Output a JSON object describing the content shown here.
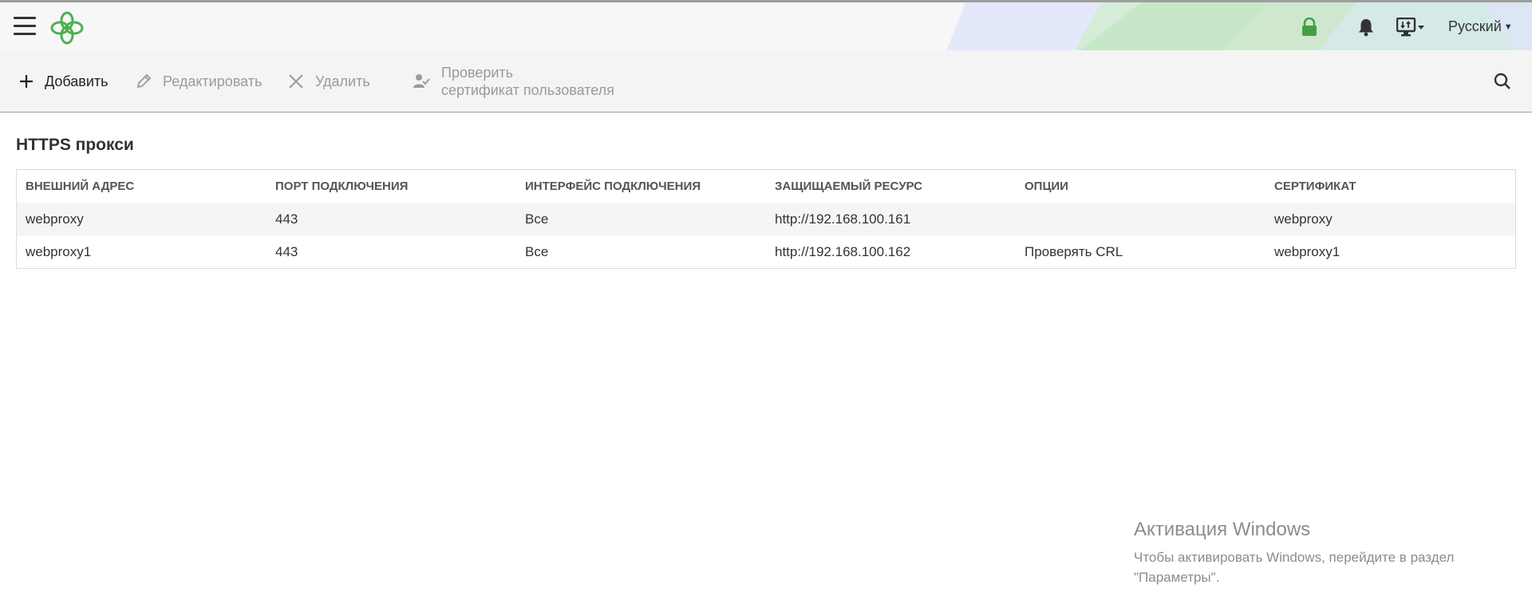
{
  "header": {
    "language": "Русский",
    "icons": {
      "menu": "hamburger-menu-icon",
      "logo": "app-logo",
      "lock": "lock-icon",
      "bell": "bell-icon",
      "display": "display-icon"
    },
    "colors": {
      "accent": "#4caf50",
      "lock": "#43a047"
    }
  },
  "toolbar": {
    "add_label": "Добавить",
    "edit_label": "Редактировать",
    "delete_label": "Удалить",
    "check_cert_line1": "Проверить",
    "check_cert_line2": "сертификат пользователя"
  },
  "page": {
    "title": "HTTPS прокси"
  },
  "table": {
    "columns": [
      "ВНЕШНИЙ АДРЕС",
      "ПОРТ ПОДКЛЮЧЕНИЯ",
      "ИНТЕРФЕЙС ПОДКЛЮЧЕНИЯ",
      "ЗАЩИЩАЕМЫЙ РЕСУРС",
      "ОПЦИИ",
      "СЕРТИФИКАТ"
    ],
    "rows": [
      [
        "webproxy",
        "443",
        "Все",
        "http://192.168.100.161",
        "",
        "webproxy"
      ],
      [
        "webproxy1",
        "443",
        "Все",
        "http://192.168.100.162",
        "Проверять CRL",
        "webproxy1"
      ]
    ]
  },
  "watermark": {
    "title": "Активация Windows",
    "line1": "Чтобы активировать Windows, перейдите в раздел",
    "line2": "\"Параметры\"."
  }
}
